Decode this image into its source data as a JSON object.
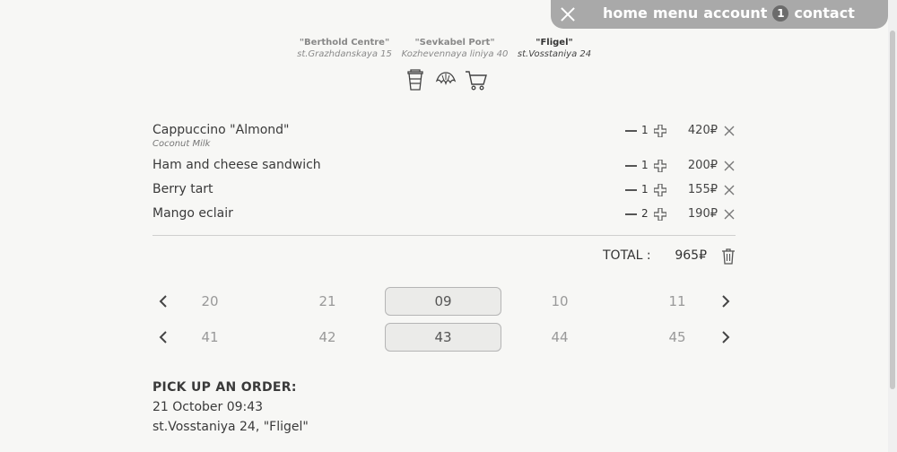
{
  "nav": {
    "links": [
      "home",
      "menu",
      "account"
    ],
    "cart_count": "1",
    "contact": "contact"
  },
  "locations": [
    {
      "name": "\"Berthold Centre\"",
      "address": "st.Grazhdanskaya 15"
    },
    {
      "name": "\"Sevkabel Port\"",
      "address": "Kozhevennaya liniya 40"
    },
    {
      "name": "\"Fligel\"",
      "address": "st.Vosstaniya 24"
    }
  ],
  "categories": [
    "coffee-cup-icon",
    "croissant-icon",
    "cart-icon"
  ],
  "order": [
    {
      "name": "Cappuccino \"Almond\"",
      "option": "Coconut Milk",
      "qty": "1",
      "price": "420₽"
    },
    {
      "name": "Ham and cheese sandwich",
      "option": "",
      "qty": "1",
      "price": "200₽"
    },
    {
      "name": "Berry tart",
      "option": "",
      "qty": "1",
      "price": "155₽"
    },
    {
      "name": "Mango eclair",
      "option": "",
      "qty": "2",
      "price": "190₽"
    }
  ],
  "total": {
    "label": "TOTAL :",
    "value": "965₽"
  },
  "hour_picker": {
    "options": [
      "20",
      "21",
      "09",
      "10",
      "11"
    ],
    "selected": "09"
  },
  "minute_picker": {
    "options": [
      "41",
      "42",
      "43",
      "44",
      "45"
    ],
    "selected": "43"
  },
  "pickup": {
    "title": "PICK UP AN ORDER:",
    "datetime": "21 October 09:43",
    "place": "st.Vosstaniya 24, \"Fligel\""
  }
}
